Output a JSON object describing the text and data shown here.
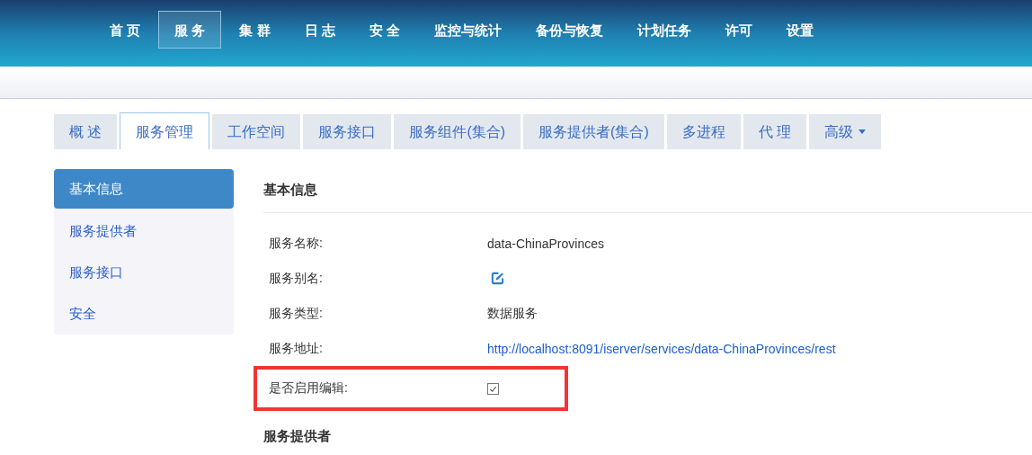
{
  "nav": [
    {
      "label": "首 页",
      "selected": false
    },
    {
      "label": "服 务",
      "selected": true
    },
    {
      "label": "集 群",
      "selected": false
    },
    {
      "label": "日 志",
      "selected": false
    },
    {
      "label": "安 全",
      "selected": false
    },
    {
      "label": "监控与统计",
      "selected": false
    },
    {
      "label": "备份与恢复",
      "selected": false
    },
    {
      "label": "计划任务",
      "selected": false
    },
    {
      "label": "许可",
      "selected": false
    },
    {
      "label": "设置",
      "selected": false
    }
  ],
  "tabs": [
    {
      "label": "概 述",
      "selected": false,
      "has_menu": false
    },
    {
      "label": "服务管理",
      "selected": true,
      "has_menu": false
    },
    {
      "label": "工作空间",
      "selected": false,
      "has_menu": false
    },
    {
      "label": "服务接口",
      "selected": false,
      "has_menu": false
    },
    {
      "label": "服务组件(集合)",
      "selected": false,
      "has_menu": false
    },
    {
      "label": "服务提供者(集合)",
      "selected": false,
      "has_menu": false
    },
    {
      "label": "多进程",
      "selected": false,
      "has_menu": false
    },
    {
      "label": "代 理",
      "selected": false,
      "has_menu": false
    },
    {
      "label": "高级",
      "selected": false,
      "has_menu": true
    }
  ],
  "sidebar": {
    "items": [
      {
        "label": "基本信息",
        "selected": true
      },
      {
        "label": "服务提供者",
        "selected": false
      },
      {
        "label": "服务接口",
        "selected": false
      },
      {
        "label": "安全",
        "selected": false
      }
    ]
  },
  "content": {
    "title": "基本信息",
    "rows": [
      {
        "label": "服务名称:",
        "kind": "text",
        "value": "data-ChinaProvinces",
        "highlighted": false
      },
      {
        "label": "服务别名:",
        "kind": "edit",
        "highlighted": false
      },
      {
        "label": "服务类型:",
        "kind": "text",
        "value": "数据服务",
        "highlighted": false
      },
      {
        "label": "服务地址:",
        "kind": "link",
        "value": "http://localhost:8091/iserver/services/data-ChinaProvinces/rest",
        "highlighted": false
      },
      {
        "label": "是否启用编辑:",
        "kind": "checkbox",
        "checked": true,
        "highlighted": true
      }
    ],
    "next_section": "服务提供者"
  }
}
